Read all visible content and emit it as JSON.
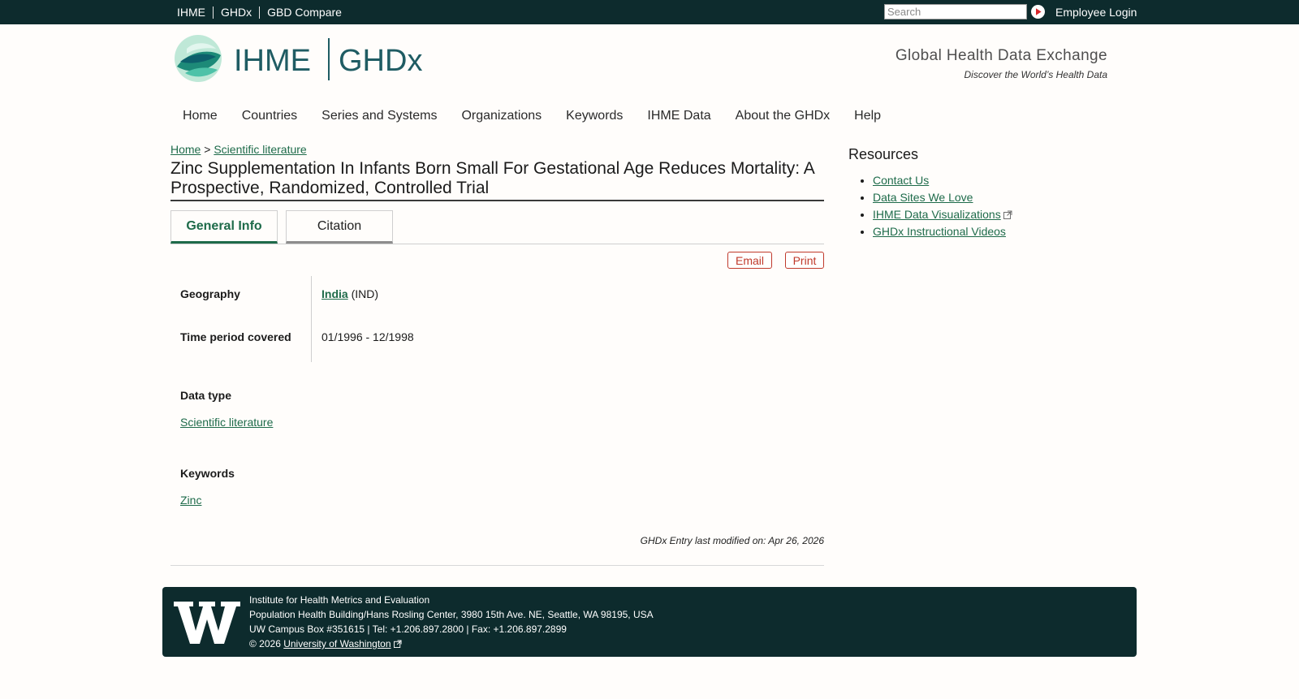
{
  "topbar": {
    "links": [
      "IHME",
      "GHDx",
      "GBD Compare"
    ],
    "search_placeholder": "Search",
    "search_value": "",
    "employee_login": "Employee Login"
  },
  "header": {
    "logo_ihme": "IHME",
    "logo_ghdx": "GHDx",
    "tagline_title": "Global Health Data Exchange",
    "tagline_sub": "Discover the World’s Health Data"
  },
  "nav": {
    "items": [
      "Home",
      "Countries",
      "Series and Systems",
      "Organizations",
      "Keywords",
      "IHME Data",
      "About the GHDx",
      "Help"
    ]
  },
  "breadcrumb": {
    "home": "Home",
    "separator": ">",
    "current": "Scientific literature"
  },
  "page": {
    "title": "Zinc Supplementation In Infants Born Small For Gestational Age Reduces Mortality: A Prospective, Randomized, Controlled Trial",
    "tabs": [
      "General Info",
      "Citation"
    ],
    "active_tab": "General Info",
    "email_label": "Email",
    "print_label": "Print"
  },
  "details": {
    "geography_label": "Geography",
    "geography_link": "India",
    "geography_code": "(IND)",
    "time_label": "Time period covered",
    "time_value": "01/1996 - 12/1998",
    "datatype_label": "Data type",
    "datatype_value": "Scientific literature",
    "keywords_label": "Keywords",
    "keywords_value": "Zinc",
    "modified": "GHDx Entry last modified on: Apr 26, 2026"
  },
  "sidebar": {
    "title": "Resources",
    "links": [
      "Contact Us",
      "Data Sites We Love",
      "IHME Data Visualizations",
      "GHDx Instructional Videos"
    ]
  },
  "footer": {
    "line1": "Institute for Health Metrics and Evaluation",
    "line2": "Population Health Building/Hans Rosling Center, 3980 15th Ave. NE, Seattle, WA 98195, USA",
    "line3": "UW Campus Box #351615 | Tel: +1.206.897.2800 | Fax: +1.206.897.2899",
    "copyright": "© 2026",
    "uw_link": "University of Washington"
  },
  "colors": {
    "topbar_bg": "#0d2b2d",
    "link_green": "#1e6b4a",
    "action_red": "#c0392b",
    "page_bg": "#fffdfb"
  }
}
